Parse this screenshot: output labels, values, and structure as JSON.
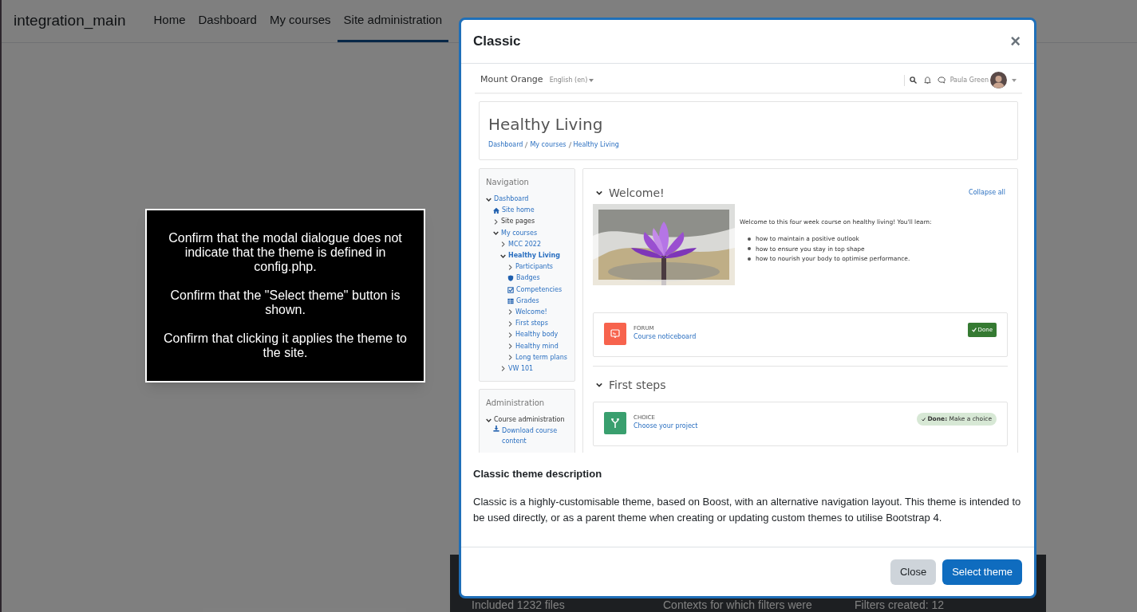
{
  "top_nav": {
    "site_name": "integration_main",
    "links": [
      {
        "label": "Home",
        "selected": false
      },
      {
        "label": "Dashboard",
        "selected": false
      },
      {
        "label": "My courses",
        "selected": false
      },
      {
        "label": "Site administration",
        "selected": true
      }
    ]
  },
  "background_panel": {
    "texts": [
      "Included 1232 files",
      "Contexts for which filters were",
      "Filters created: 12"
    ]
  },
  "instructions": [
    "Confirm that the modal dialogue does not indicate that the theme is defined in config.php.",
    "Confirm that the \"Select theme\" button is shown.",
    "Confirm that clicking it applies the theme to the site."
  ],
  "modal": {
    "title": "Classic",
    "close": "×",
    "preview": {
      "site_name": "Mount Orange",
      "language": "English (en)",
      "user_name": "Paula Green",
      "course_title": "Healthy Living",
      "breadcrumb": [
        "Dashboard",
        "My courses",
        "Healthy Living"
      ],
      "navigation": {
        "title": "Navigation",
        "items": [
          {
            "label": "Dashboard",
            "kind": "branch",
            "expanded": true,
            "link": true,
            "selected": false,
            "children": [
              {
                "label": "Site home",
                "kind": "home",
                "link": true,
                "selected": false
              },
              {
                "label": "Site pages",
                "kind": "branch",
                "expanded": false,
                "link": false,
                "selected": false
              },
              {
                "label": "My courses",
                "kind": "branch",
                "expanded": true,
                "link": true,
                "selected": false,
                "children": [
                  {
                    "label": "MCC 2022",
                    "kind": "branch",
                    "expanded": false,
                    "link": true,
                    "selected": false
                  },
                  {
                    "label": "Healthy Living",
                    "kind": "branch",
                    "expanded": true,
                    "link": true,
                    "selected": true,
                    "children": [
                      {
                        "label": "Participants",
                        "kind": "branch",
                        "expanded": false,
                        "link": true,
                        "selected": false
                      },
                      {
                        "label": "Badges",
                        "kind": "badge",
                        "link": true,
                        "selected": false
                      },
                      {
                        "label": "Competencies",
                        "kind": "competency",
                        "link": true,
                        "selected": false
                      },
                      {
                        "label": "Grades",
                        "kind": "grades",
                        "link": true,
                        "selected": false
                      },
                      {
                        "label": "Welcome!",
                        "kind": "branch",
                        "expanded": false,
                        "link": true,
                        "selected": false
                      },
                      {
                        "label": "First steps",
                        "kind": "branch",
                        "expanded": false,
                        "link": true,
                        "selected": false
                      },
                      {
                        "label": "Healthy body",
                        "kind": "branch",
                        "expanded": false,
                        "link": true,
                        "selected": false
                      },
                      {
                        "label": "Healthy mind",
                        "kind": "branch",
                        "expanded": false,
                        "link": true,
                        "selected": false
                      },
                      {
                        "label": "Long term plans",
                        "kind": "branch",
                        "expanded": false,
                        "link": true,
                        "selected": false
                      }
                    ]
                  },
                  {
                    "label": "VW 101",
                    "kind": "branch",
                    "expanded": false,
                    "link": true,
                    "selected": false
                  }
                ]
              }
            ]
          }
        ]
      },
      "administration": {
        "title": "Administration",
        "items": [
          {
            "label": "Course administration",
            "kind": "branch",
            "expanded": true,
            "link": false,
            "selected": false,
            "children": [
              {
                "label": "Download course content",
                "kind": "download",
                "link": true,
                "selected": false
              }
            ]
          }
        ]
      },
      "sections": [
        {
          "title": "Welcome!",
          "collapse_all": "Collapse all",
          "intro": "Welcome to this four week course on healthy living! You'll learn:",
          "bullets": [
            "how to maintain a positive outlook",
            "how to ensure you stay in top shape",
            "how to nourish your body to optimise performance."
          ],
          "activities": [
            {
              "kind": "forum",
              "type": "FORUM",
              "name": "Course noticeboard",
              "completion": {
                "kind": "button",
                "label": "Done"
              }
            }
          ]
        },
        {
          "title": "First steps",
          "activities": [
            {
              "kind": "choice",
              "type": "CHOICE",
              "name": "Choose your project",
              "completion": {
                "kind": "pill",
                "label": "**Done:** Make a choice"
              }
            }
          ]
        }
      ]
    },
    "description_title": "Classic theme description",
    "description": "Classic is a highly-customisable theme, based on Boost, with an alternative navigation layout. This theme is intended to be used directly, or as a parent theme when creating or updating custom themes to utilise Bootstrap 4.",
    "buttons": [
      {
        "label": "Close",
        "kind": "secondary"
      },
      {
        "label": "Select theme",
        "kind": "primary"
      }
    ]
  }
}
